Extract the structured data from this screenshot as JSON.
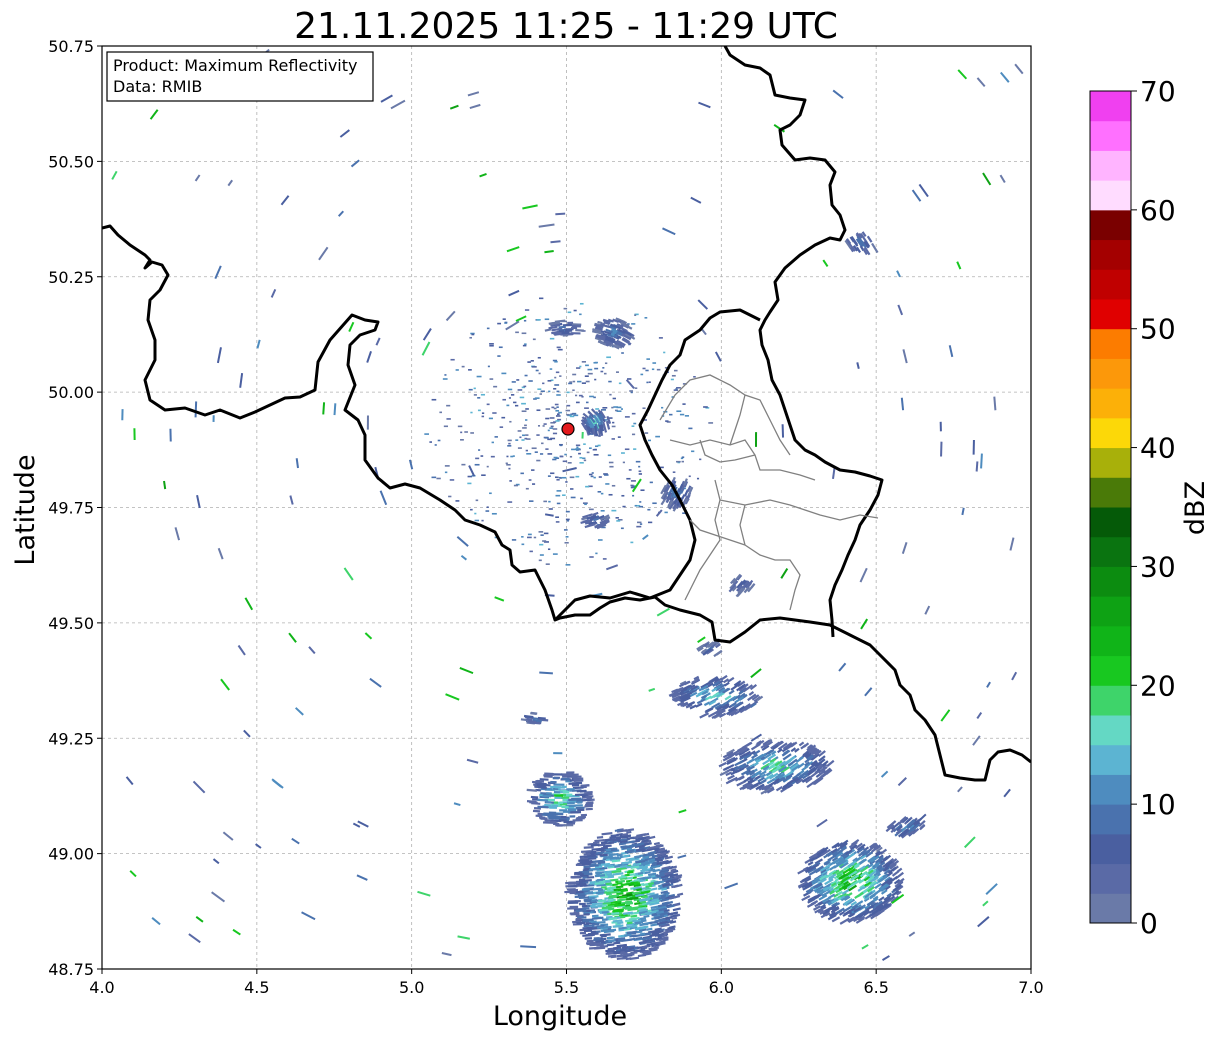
{
  "title": "21.11.2025 11:25 - 11:29 UTC",
  "xlabel": "Longitude",
  "ylabel": "Latitude",
  "info_box": {
    "product": "Product: Maximum Reflectivity",
    "data": "Data: RMIB"
  },
  "x_ticks": [
    "4.0",
    "4.5",
    "5.0",
    "5.5",
    "6.0",
    "6.5",
    "7.0"
  ],
  "y_ticks": [
    "50.75",
    "50.50",
    "50.25",
    "50.00",
    "49.75",
    "49.50",
    "49.25",
    "49.00",
    "48.75"
  ],
  "colorbar": {
    "label": "dBZ",
    "ticks": [
      "0",
      "10",
      "20",
      "30",
      "40",
      "50",
      "60",
      "70"
    ],
    "range": [
      0,
      70
    ],
    "colors": [
      "#6a7aa8",
      "#5a6aa6",
      "#4a5fa0",
      "#4a72ae",
      "#4e8cbf",
      "#5cb4d2",
      "#64d8c4",
      "#3ed46a",
      "#18c820",
      "#10b418",
      "#0ea214",
      "#0c8c10",
      "#0a7410",
      "#055a08",
      "#4a7a08",
      "#a8b00a",
      "#fcd808",
      "#fcb008",
      "#fc980a",
      "#fc7c00",
      "#e00000",
      "#c00000",
      "#a40000",
      "#7a0000",
      "#ffdcff",
      "#ffb4ff",
      "#ff70ff",
      "#f040f0"
    ]
  },
  "map": {
    "lon_range": [
      4.0,
      7.0
    ],
    "lat_range": [
      48.75,
      50.75
    ],
    "radar_site": {
      "lon": 5.505,
      "lat": 49.915
    },
    "border_color": "#000000",
    "admin_color": "#808080"
  }
}
